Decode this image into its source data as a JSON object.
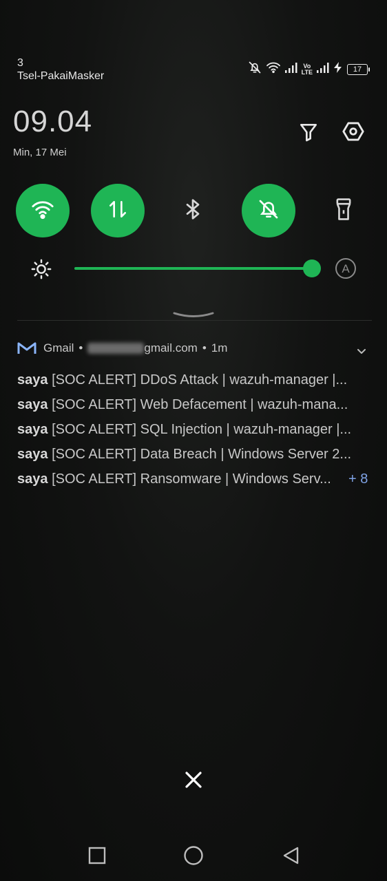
{
  "status_bar": {
    "carrier_line1": "3",
    "carrier_line2": "Tsel-PakaiMasker",
    "volte_top": "Vo",
    "volte_bottom": "LTE",
    "battery": "17",
    "icons": [
      "dnd-off-icon",
      "wifi-icon",
      "signal-icon",
      "volte-icon",
      "signal-icon",
      "charging-icon",
      "battery-icon"
    ]
  },
  "header": {
    "time": "09.04",
    "date": "Min, 17 Mei",
    "icons": [
      "filter-icon",
      "settings-icon"
    ]
  },
  "quick_settings": [
    {
      "name": "wifi",
      "icon": "wifi-icon",
      "on": true
    },
    {
      "name": "mobile-data",
      "icon": "data-arrows-icon",
      "on": true
    },
    {
      "name": "bluetooth",
      "icon": "bluetooth-icon",
      "on": false
    },
    {
      "name": "silent",
      "icon": "bell-off-icon",
      "on": true
    },
    {
      "name": "flashlight",
      "icon": "flashlight-icon",
      "on": false
    }
  ],
  "brightness": {
    "level": 1.0,
    "auto_label": "A"
  },
  "notification": {
    "app": "Gmail",
    "bullet": "•",
    "account_suffix": "gmail.com",
    "time": "1m",
    "messages": [
      {
        "sender": "saya",
        "text": "[SOC ALERT] DDoS Attack | wazuh-manager |..."
      },
      {
        "sender": "saya",
        "text": "[SOC ALERT] Web Defacement | wazuh-mana..."
      },
      {
        "sender": "saya",
        "text": "[SOC ALERT] SQL Injection | wazuh-manager |..."
      },
      {
        "sender": "saya",
        "text": "[SOC ALERT] Data Breach | Windows Server 2..."
      },
      {
        "sender": "saya",
        "text": "[SOC ALERT] Ransomware | Windows Serv..."
      }
    ],
    "more": "+ 8"
  },
  "colors": {
    "accent": "#1fb555",
    "link": "#7fa3e6",
    "gmail": "#8ab4f8"
  }
}
